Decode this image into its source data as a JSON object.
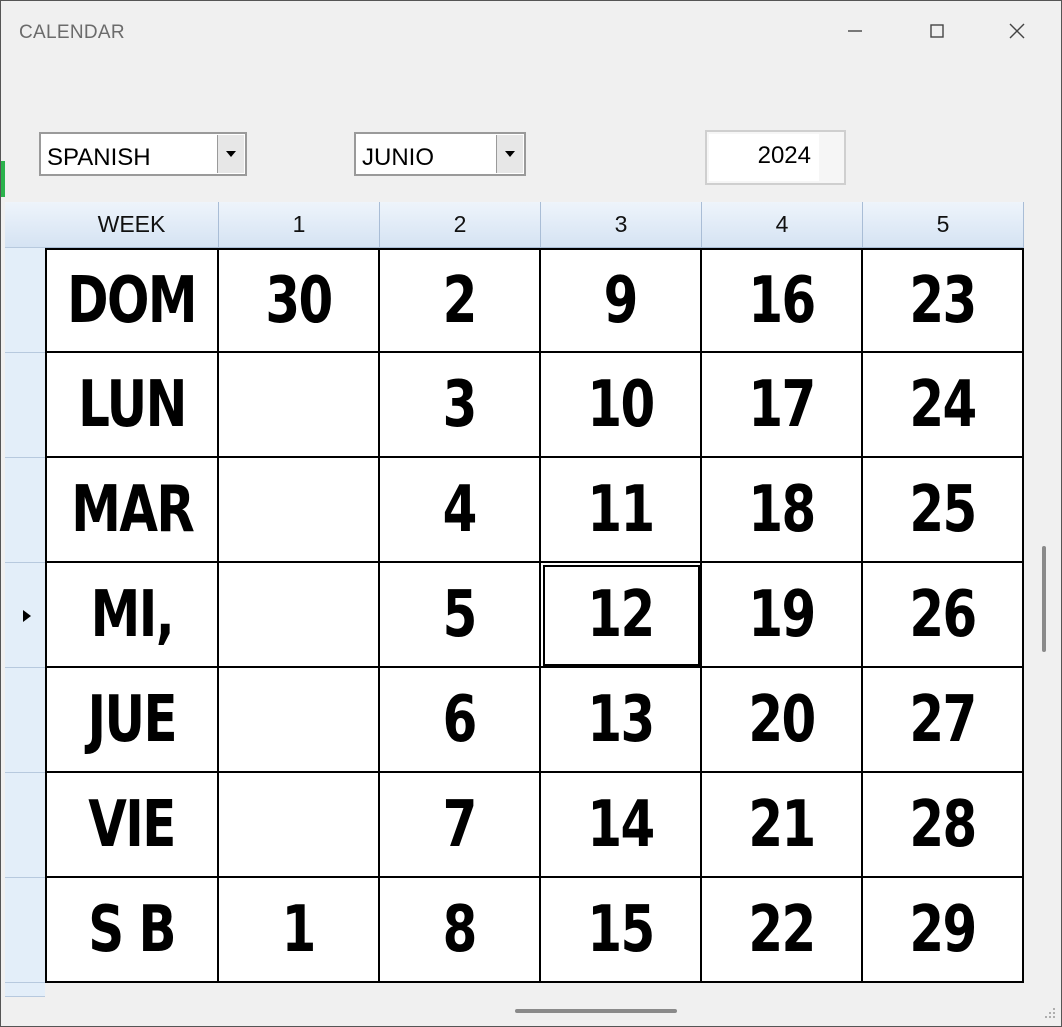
{
  "window": {
    "title": "CALENDAR"
  },
  "controls": {
    "language": "SPANISH",
    "month": "JUNIO",
    "year": "2024"
  },
  "grid": {
    "headers": [
      "WEEK",
      "1",
      "2",
      "3",
      "4",
      "5"
    ],
    "rows": [
      [
        "DOM",
        "30",
        "2",
        "9",
        "16",
        "23"
      ],
      [
        "LUN",
        "",
        "3",
        "10",
        "17",
        "24"
      ],
      [
        "MAR",
        "",
        "4",
        "11",
        "18",
        "25"
      ],
      [
        "MI,",
        "",
        "5",
        "12",
        "19",
        "26"
      ],
      [
        "JUE",
        "",
        "6",
        "13",
        "20",
        "27"
      ],
      [
        "VIE",
        "",
        "7",
        "14",
        "21",
        "28"
      ],
      [
        "S B",
        "1",
        "8",
        "15",
        "22",
        "29"
      ]
    ],
    "current_row": 3,
    "selected_col": 3
  },
  "colors": {
    "header_bg": "#d5e3f3",
    "row_header_bg": "#e3eef9",
    "grid_line": "#000000"
  },
  "icons": {
    "minimize": "minimize-icon",
    "maximize": "maximize-icon",
    "close": "close-icon",
    "dropdown": "chevron-down-icon",
    "row_pointer": "triangle-right-icon"
  }
}
